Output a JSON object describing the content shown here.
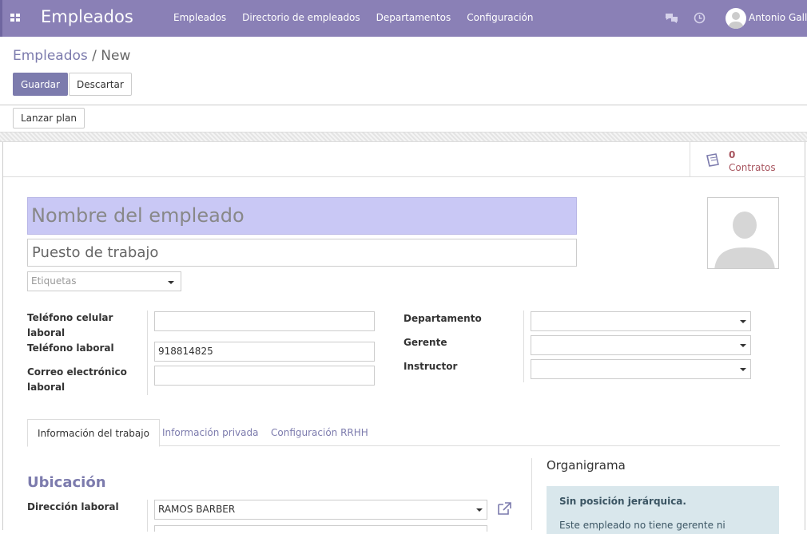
{
  "topbar": {
    "app_title": "Empleados",
    "menu": [
      "Empleados",
      "Directorio de empleados",
      "Departamentos",
      "Configuración"
    ],
    "user_name": "Antonio Galli"
  },
  "breadcrumb": {
    "parent": "Empleados",
    "separator": "/",
    "current": "New"
  },
  "buttons": {
    "save": "Guardar",
    "discard": "Descartar",
    "launch_plan": "Lanzar plan"
  },
  "stat": {
    "contracts_count": "0",
    "contracts_label": "Contratos"
  },
  "form": {
    "name_placeholder": "Nombre del empleado",
    "job_placeholder": "Puesto de trabajo",
    "tags_placeholder": "Etiquetas",
    "mobile_label": "Teléfono celular laboral",
    "work_phone_label": "Teléfono laboral",
    "work_phone_value": "918814825",
    "email_label": "Correo electrónico laboral",
    "department_label": "Departamento",
    "manager_label": "Gerente",
    "coach_label": "Instructor"
  },
  "tabs": [
    "Información del trabajo",
    "Información privada",
    "Configuración RRHH"
  ],
  "location": {
    "title": "Ubicación",
    "address_label": "Dirección laboral",
    "address_value": "RAMOS BARBER"
  },
  "org": {
    "title": "Organigrama",
    "box_title": "Sin posición jerárquica.",
    "box_text": "Este empleado no tiene gerente ni"
  },
  "colors": {
    "brand": "#8a80b6",
    "accent": "#7c7bad",
    "stat": "#a8555f"
  }
}
